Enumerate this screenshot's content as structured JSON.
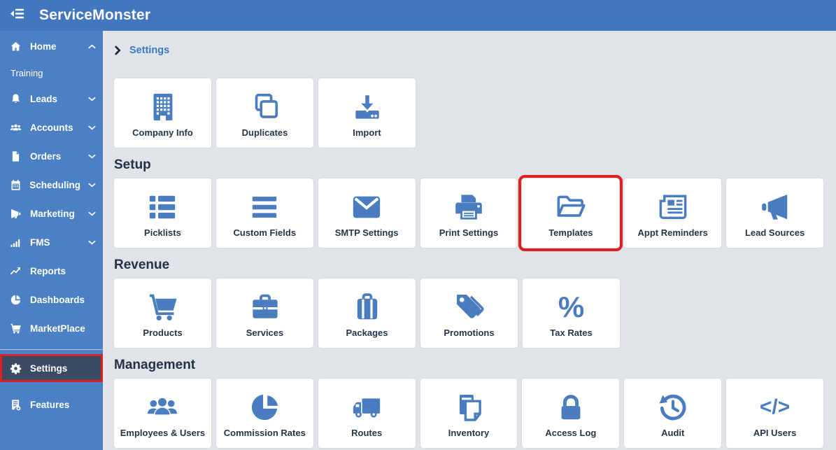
{
  "app": {
    "title": "ServiceMonster"
  },
  "header": {
    "collapse_icon": "outdent-icon"
  },
  "colors": {
    "header_bg": "#4277bd",
    "sidebar_bg": "#4b80c4",
    "active_item_bg": "#3c4b64",
    "highlight_red": "#dd2020",
    "icon_blue": "#4a7dbf",
    "content_bg": "#e0e3e7",
    "tile_label": "#25364a",
    "breadcrumb_link": "#3c7ac1"
  },
  "sidebar": {
    "items": [
      {
        "label": "Home",
        "icon": "home-icon",
        "chevron": "up"
      },
      {
        "label": "Training",
        "sub": true
      },
      {
        "label": "Leads",
        "icon": "bell-icon",
        "chevron": "down"
      },
      {
        "label": "Accounts",
        "icon": "users-icon",
        "chevron": "down"
      },
      {
        "label": "Orders",
        "icon": "file-icon",
        "chevron": "down"
      },
      {
        "label": "Scheduling",
        "icon": "calendar-icon",
        "chevron": "down"
      },
      {
        "label": "Marketing",
        "icon": "megaphone-left-icon",
        "chevron": "down"
      },
      {
        "label": "FMS",
        "icon": "signal-bars-icon",
        "chevron": "down"
      },
      {
        "label": "Reports",
        "icon": "line-chart-icon"
      },
      {
        "label": "Dashboards",
        "icon": "pie-chart-icon"
      },
      {
        "label": "MarketPlace",
        "icon": "shopping-cart-icon"
      },
      {
        "divider": true
      },
      {
        "label": "Settings",
        "icon": "gear-icon",
        "active": true,
        "highlighted": true
      },
      {
        "label": "Features",
        "icon": "feature-list-icon"
      }
    ]
  },
  "breadcrumb": {
    "label": "Settings"
  },
  "main": {
    "sections": [
      {
        "label": null,
        "tiles": [
          {
            "label": "Company Info",
            "icon": "building-icon"
          },
          {
            "label": "Duplicates",
            "icon": "duplicates-icon"
          },
          {
            "label": "Import",
            "icon": "import-icon"
          }
        ]
      },
      {
        "label": "Setup",
        "tiles": [
          {
            "label": "Picklists",
            "icon": "picklist-icon"
          },
          {
            "label": "Custom Fields",
            "icon": "bars-icon"
          },
          {
            "label": "SMTP Settings",
            "icon": "envelope-icon"
          },
          {
            "label": "Print Settings",
            "icon": "printer-icon"
          },
          {
            "label": "Templates",
            "icon": "folder-open-icon",
            "highlighted": true
          },
          {
            "label": "Appt Reminders",
            "icon": "newspaper-icon"
          },
          {
            "label": "Lead Sources",
            "icon": "megaphone-right-icon"
          }
        ]
      },
      {
        "label": "Revenue",
        "tiles": [
          {
            "label": "Products",
            "icon": "shopping-cart-icon"
          },
          {
            "label": "Services",
            "icon": "toolbox-icon"
          },
          {
            "label": "Packages",
            "icon": "suitcase-icon"
          },
          {
            "label": "Promotions",
            "icon": "tags-icon"
          },
          {
            "label": "Tax Rates",
            "icon": "percent-icon"
          }
        ]
      },
      {
        "label": "Management",
        "tiles": [
          {
            "label": "Employees & Users",
            "icon": "users-group-icon"
          },
          {
            "label": "Commission Rates",
            "icon": "pie-slice-icon"
          },
          {
            "label": "Routes",
            "icon": "truck-icon"
          },
          {
            "label": "Inventory",
            "icon": "copy-pages-icon"
          },
          {
            "label": "Access Log",
            "icon": "lock-icon"
          },
          {
            "label": "Audit",
            "icon": "history-icon"
          },
          {
            "label": "API Users",
            "icon": "code-icon"
          }
        ]
      }
    ]
  }
}
